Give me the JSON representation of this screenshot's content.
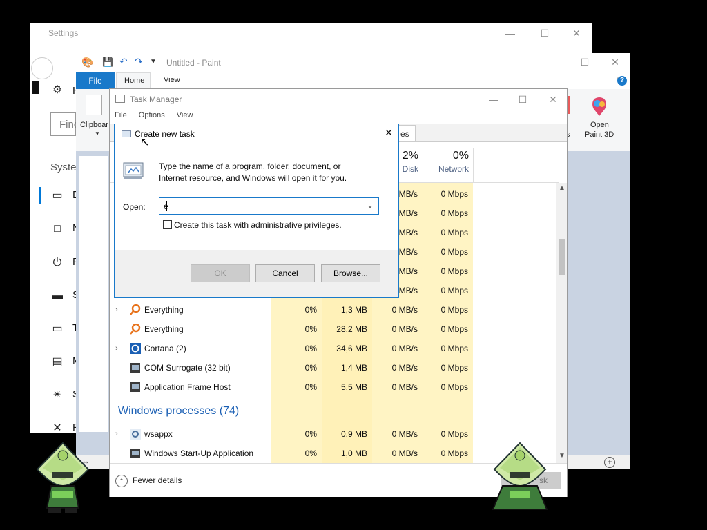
{
  "settings": {
    "title": "Settings",
    "search_placeholder": "Find",
    "section_label": "System",
    "sidebar_letters": [
      "H",
      "D",
      "N",
      "P",
      "S",
      "T",
      "M",
      "S",
      "F",
      "A"
    ]
  },
  "paint": {
    "title": "Untitled - Paint",
    "file_tab": "File",
    "tabs": [
      "Home",
      "View"
    ],
    "clipboard_label": "Clipboar",
    "open_paint3d_line1": "Open",
    "open_paint3d_line2": "Paint 3D",
    "ribbon_fragment_s": "s"
  },
  "task_manager": {
    "title": "Task Manager",
    "menu": [
      "File",
      "Options",
      "View"
    ],
    "tab_fragment": "es",
    "columns": {
      "disk": {
        "pct": "2%",
        "label": "Disk"
      },
      "network": {
        "pct": "0%",
        "label": "Network"
      }
    },
    "hidden_rows": [
      {
        "disk": "MB/s",
        "network": "0 Mbps"
      },
      {
        "disk": "MB/s",
        "network": "0 Mbps"
      },
      {
        "disk": "MB/s",
        "network": "0 Mbps"
      },
      {
        "disk": "MB/s",
        "network": "0 Mbps"
      },
      {
        "disk": "MB/s",
        "network": "0 Mbps"
      },
      {
        "disk": "MB/s",
        "network": "0 Mbps"
      }
    ],
    "processes": [
      {
        "name": "Everything",
        "expandable": true,
        "cpu": "0%",
        "memory": "1,3 MB",
        "disk": "0 MB/s",
        "network": "0 Mbps",
        "icon": "everything-icon"
      },
      {
        "name": "Everything",
        "expandable": false,
        "cpu": "0%",
        "memory": "28,2 MB",
        "disk": "0 MB/s",
        "network": "0 Mbps",
        "icon": "everything-icon"
      },
      {
        "name": "Cortana (2)",
        "expandable": true,
        "cpu": "0%",
        "memory": "34,6 MB",
        "disk": "0 MB/s",
        "network": "0 Mbps",
        "icon": "cortana-icon"
      },
      {
        "name": "COM Surrogate (32 bit)",
        "expandable": false,
        "cpu": "0%",
        "memory": "1,4 MB",
        "disk": "0 MB/s",
        "network": "0 Mbps",
        "icon": "app-icon"
      },
      {
        "name": "Application Frame Host",
        "expandable": false,
        "cpu": "0%",
        "memory": "5,5 MB",
        "disk": "0 MB/s",
        "network": "0 Mbps",
        "icon": "app-icon"
      }
    ],
    "group_header": "Windows processes (74)",
    "windows_processes": [
      {
        "name": "wsappx",
        "expandable": true,
        "cpu": "0%",
        "memory": "0,9 MB",
        "disk": "0 MB/s",
        "network": "0 Mbps",
        "icon": "gear-icon"
      },
      {
        "name": "Windows Start-Up Application",
        "expandable": false,
        "cpu": "0%",
        "memory": "1,0 MB",
        "disk": "0 MB/s",
        "network": "0 Mbps",
        "icon": "app-icon"
      }
    ],
    "fewer_details": "Fewer details",
    "end_task_fragment": "sk"
  },
  "dialog": {
    "title": "Create new task",
    "description_line1": "Type the name of a program, folder, document, or",
    "description_line2": "Internet resource, and Windows will open it for you.",
    "open_label": "Open:",
    "open_value": "e",
    "admin_checkbox_label": "Create this task with administrative privileges.",
    "ok_label": "OK",
    "cancel_label": "Cancel",
    "browse_label": "Browse..."
  }
}
